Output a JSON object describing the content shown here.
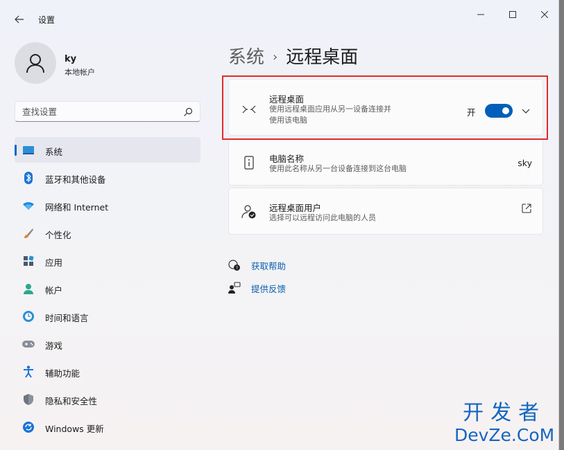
{
  "window": {
    "app_title": "设置"
  },
  "user": {
    "name": "ky",
    "account_type": "本地帐户"
  },
  "search": {
    "placeholder": "查找设置"
  },
  "sidebar": {
    "items": [
      {
        "label": "系统",
        "icon": "system-monitor-icon",
        "active": true
      },
      {
        "label": "蓝牙和其他设备",
        "icon": "bluetooth-icon"
      },
      {
        "label": "网络和 Internet",
        "icon": "wifi-icon"
      },
      {
        "label": "个性化",
        "icon": "brush-icon"
      },
      {
        "label": "应用",
        "icon": "apps-icon"
      },
      {
        "label": "帐户",
        "icon": "person-icon"
      },
      {
        "label": "时间和语言",
        "icon": "clock-globe-icon"
      },
      {
        "label": "游戏",
        "icon": "gamepad-icon"
      },
      {
        "label": "辅助功能",
        "icon": "accessibility-icon"
      },
      {
        "label": "隐私和安全性",
        "icon": "shield-icon"
      },
      {
        "label": "Windows 更新",
        "icon": "update-icon"
      }
    ]
  },
  "breadcrumb": {
    "parent": "系统",
    "separator": "›",
    "current": "远程桌面"
  },
  "remote_desktop": {
    "title": "远程桌面",
    "description": "使用远程桌面应用从另一设备连接并使用该电脑",
    "toggle_state": "开",
    "enabled": true
  },
  "pc_name": {
    "title": "电脑名称",
    "description": "使用此名称从另一台设备连接到这台电脑",
    "value": "sky"
  },
  "remote_users": {
    "title": "远程桌面用户",
    "description": "选择可以远程访问此电脑的人员"
  },
  "links": {
    "help": "获取帮助",
    "feedback": "提供反馈"
  },
  "watermark": {
    "line1": "开发者",
    "line2": "DevZe.CoM"
  },
  "colors": {
    "accent": "#005fb8",
    "highlight_border": "#e02b2b",
    "link": "#0a5fae"
  }
}
